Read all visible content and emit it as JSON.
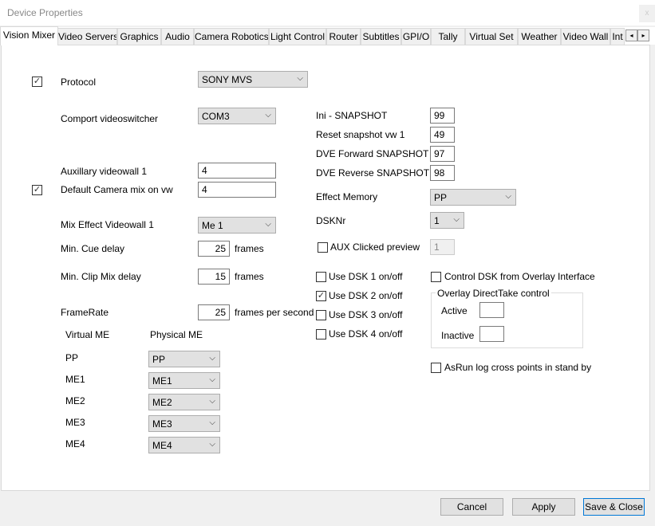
{
  "window": {
    "title": "Device Properties",
    "close": "x"
  },
  "tabs": [
    "Vision Mixer",
    "Video Servers",
    "Graphics",
    "Audio",
    "Camera Robotics",
    "Light Control",
    "Router",
    "Subtitles",
    "GPI/O",
    "Tally",
    "Virtual Set",
    "Weather",
    "Video Wall",
    "Int"
  ],
  "tab_arrows": {
    "left": "◂",
    "right": "▸"
  },
  "selected_tab": "Vision Mixer",
  "form": {
    "protocol": {
      "label": "Protocol",
      "checked": true,
      "value": "SONY MVS"
    },
    "comport": {
      "label": "Comport videoswitcher",
      "value": "COM3"
    },
    "aux_videowall": {
      "label": "Auxillary videowall 1",
      "value": "4"
    },
    "default_camera": {
      "label": "Default Camera mix on vw",
      "checked": true,
      "value": "4"
    },
    "mix_effect": {
      "label": "Mix Effect Videowall 1",
      "value": "Me 1"
    },
    "min_cue": {
      "label": "Min. Cue delay",
      "value": "25",
      "unit": "frames"
    },
    "min_clip": {
      "label": "Min. Clip Mix delay",
      "value": "15",
      "unit": "frames"
    },
    "framerate": {
      "label": "FrameRate",
      "value": "25",
      "unit": "frames per second"
    },
    "me_headers": {
      "virtual": "Virtual ME",
      "physical": "Physical ME"
    },
    "me_rows": [
      {
        "virtual": "PP",
        "physical": "PP"
      },
      {
        "virtual": "ME1",
        "physical": "ME1"
      },
      {
        "virtual": "ME2",
        "physical": "ME2"
      },
      {
        "virtual": "ME3",
        "physical": "ME3"
      },
      {
        "virtual": "ME4",
        "physical": "ME4"
      }
    ],
    "snapshots": [
      {
        "label": "Ini - SNAPSHOT",
        "value": "99"
      },
      {
        "label": "Reset snapshot vw 1",
        "value": "49"
      },
      {
        "label": "DVE Forward SNAPSHOT",
        "value": "97"
      },
      {
        "label": "DVE Reverse SNAPSHOT",
        "value": "98"
      }
    ],
    "effect_memory": {
      "label": "Effect Memory",
      "value": "PP"
    },
    "dsknr": {
      "label": "DSKNr",
      "value": "1"
    },
    "aux_clicked": {
      "label": "AUX Clicked preview",
      "checked": false,
      "value": "1"
    },
    "dsk": [
      {
        "label": "Use DSK 1 on/off",
        "checked": false
      },
      {
        "label": "Use DSK 2 on/off",
        "checked": true
      },
      {
        "label": "Use DSK 3 on/off",
        "checked": false
      },
      {
        "label": "Use DSK 4 on/off",
        "checked": false
      }
    ],
    "control_dsk": {
      "label": "Control DSK from Overlay Interface",
      "checked": false
    },
    "overlay_group": {
      "title": "Overlay DirectTake control",
      "active": "Active",
      "inactive": "Inactive",
      "active_value": "",
      "inactive_value": ""
    },
    "asrun": {
      "label": "AsRun log cross points in stand by",
      "checked": false
    }
  },
  "buttons": {
    "cancel": "Cancel",
    "apply": "Apply",
    "save_close": "Save & Close"
  }
}
